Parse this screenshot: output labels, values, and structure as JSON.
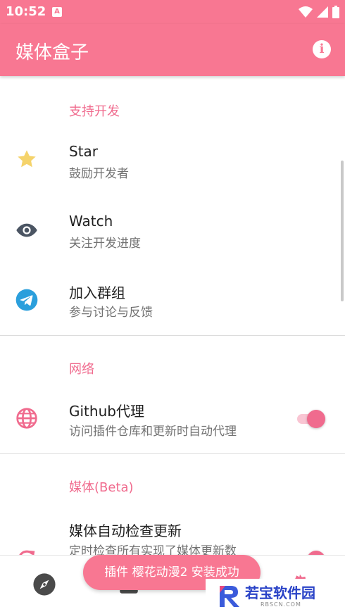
{
  "status_bar": {
    "time": "10:52",
    "notification_letter": "A"
  },
  "app_bar": {
    "title": "媒体盒子",
    "info_glyph": "i",
    "info_icon": "info-icon"
  },
  "sections": {
    "support": {
      "header": "支持开发",
      "items": [
        {
          "label": "Star",
          "sub": "鼓励开发者",
          "icon": "star-icon",
          "icon_color": "#f5d36b"
        },
        {
          "label": "Watch",
          "sub": "关注开发进度",
          "icon": "eye-icon",
          "icon_color": "#4b5563"
        },
        {
          "label": "加入群组",
          "sub": "参与讨论与反馈",
          "icon": "telegram-icon",
          "icon_color": "#2b9fdc"
        }
      ]
    },
    "network": {
      "header": "网络",
      "items": [
        {
          "label": "Github代理",
          "sub": "访问插件仓库和更新时自动代理",
          "icon": "globe-icon",
          "icon_color": "#f06b8e",
          "toggle_on": true
        }
      ]
    },
    "media": {
      "header": "媒体(Beta)",
      "items": [
        {
          "label": "媒体自动检查更新",
          "sub": "定时检查所有实现了媒体更新数",
          "icon": "update-icon",
          "icon_color": "#f06b8e",
          "toggle_on": true
        }
      ]
    }
  },
  "toast": {
    "text": "插件 樱花动漫2 安装成功"
  },
  "bottom_nav": {
    "items": [
      "compass-icon",
      "library-icon",
      "settings-icon"
    ]
  },
  "watermark": {
    "text": "若宝软件园",
    "small": "RBSCN.COM"
  },
  "colors": {
    "primary": "#f87792",
    "accent": "#f06b8e"
  }
}
